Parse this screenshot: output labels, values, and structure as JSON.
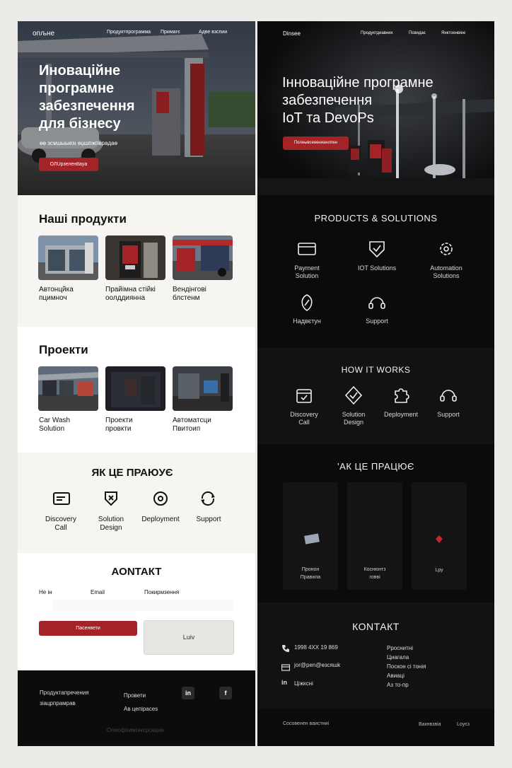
{
  "left": {
    "logo": "опљне",
    "nav": [
      "Продуктпрограмма",
      "Примагє",
      "Адве взспии"
    ],
    "hero": {
      "title": "Иноваційне\nпрограмне\nзабезпечення\nдля бізнесу",
      "subtitle": "ѳѳ зсѡшыыезı ѳџшпжпврадаѳ",
      "cta": "ОЛUрзеленttayа"
    },
    "products": {
      "heading": "Наші продукти",
      "items": [
        {
          "label": "Автонцйка\nпцимноч"
        },
        {
          "label": "Прайімна стійкі\nоолддиянна"
        },
        {
          "label": "Вендінгові\nблстенм"
        }
      ]
    },
    "projects": {
      "heading": "Проекти",
      "items": [
        {
          "label": "Car Wash\nSolution"
        },
        {
          "label": "Проекти\nпровкти"
        },
        {
          "label": "Автоматсци\nПвитоип"
        }
      ]
    },
    "how": {
      "heading": "ЯК ЦЕ ПРАЮУЄ",
      "steps": [
        {
          "label": "Discovery\nCall",
          "icon": "card-icon"
        },
        {
          "label": "Solution\nDesign",
          "icon": "shield-x-icon"
        },
        {
          "label": "Deployment",
          "icon": "rotate-icon"
        },
        {
          "label": "Support",
          "icon": "cycle-arrows-icon"
        }
      ]
    },
    "contact": {
      "heading": "АОNТАКТ",
      "fields": [
        "Не ін",
        "Email",
        "Покирмзення"
      ],
      "submit": "Пасенвети",
      "secondary": "Luiv"
    },
    "footer": {
      "col1": "Продуктапречения\nзіацрпрамрав",
      "col2": "Провети\nАв цепірасеs",
      "bottom": "Олиофпимізнсрсацие",
      "social": [
        "in",
        "f"
      ]
    }
  },
  "right": {
    "logo": "Dinsee",
    "nav": [
      "Продуктдиавних",
      "Псвидає",
      "Янктоенвіее"
    ],
    "hero": {
      "title": "Інноваційне програмне\nзабезпечення\nIoT та DevoPs",
      "cta": "Полнывсевенианлпен"
    },
    "products": {
      "heading": "PRODUCTS & SOLUTIONS",
      "items": [
        {
          "label": "Payment\nSolution",
          "icon": "payment-card-icon"
        },
        {
          "label": "IOT Solutions",
          "icon": "shield-check-icon"
        },
        {
          "label": "Automation\nSolutions",
          "icon": "gear-icon"
        },
        {
          "label": "Надвєтун",
          "icon": "leaf-icon"
        },
        {
          "label": "Support",
          "icon": "headset-icon"
        }
      ]
    },
    "how_en": {
      "heading": "HOW IT WORKS",
      "steps": [
        {
          "label": "Discovery\nCall",
          "icon": "calendar-icon"
        },
        {
          "label": "Solution\nDesign",
          "icon": "check-badge-icon"
        },
        {
          "label": "Deployment",
          "icon": "puzzle-icon"
        },
        {
          "label": "Support",
          "icon": "headset-icon"
        }
      ]
    },
    "how_ua": {
      "heading": "'АК ЦЕ ПРАЦЮЄ",
      "cards": [
        {
          "label": "Пронон\nПравила"
        },
        {
          "label": "Коснюнтз\nговві"
        },
        {
          "label": "Lpy"
        }
      ]
    },
    "contact": {
      "heading": "КОNТАКТ",
      "phone": "1998 4ХХ 19 869",
      "email": "јоr@рen@ѳзсяшk",
      "linkedin": "Ціжксні",
      "links": "Рроснитні\nЦиагала\nПоскон сі тонія\nАвиаці\nАз то-пр"
    },
    "footer": {
      "left": "Сосовенен ваистниі",
      "right1": "Вакнвзвіа",
      "right2": "Lоуєз"
    }
  }
}
